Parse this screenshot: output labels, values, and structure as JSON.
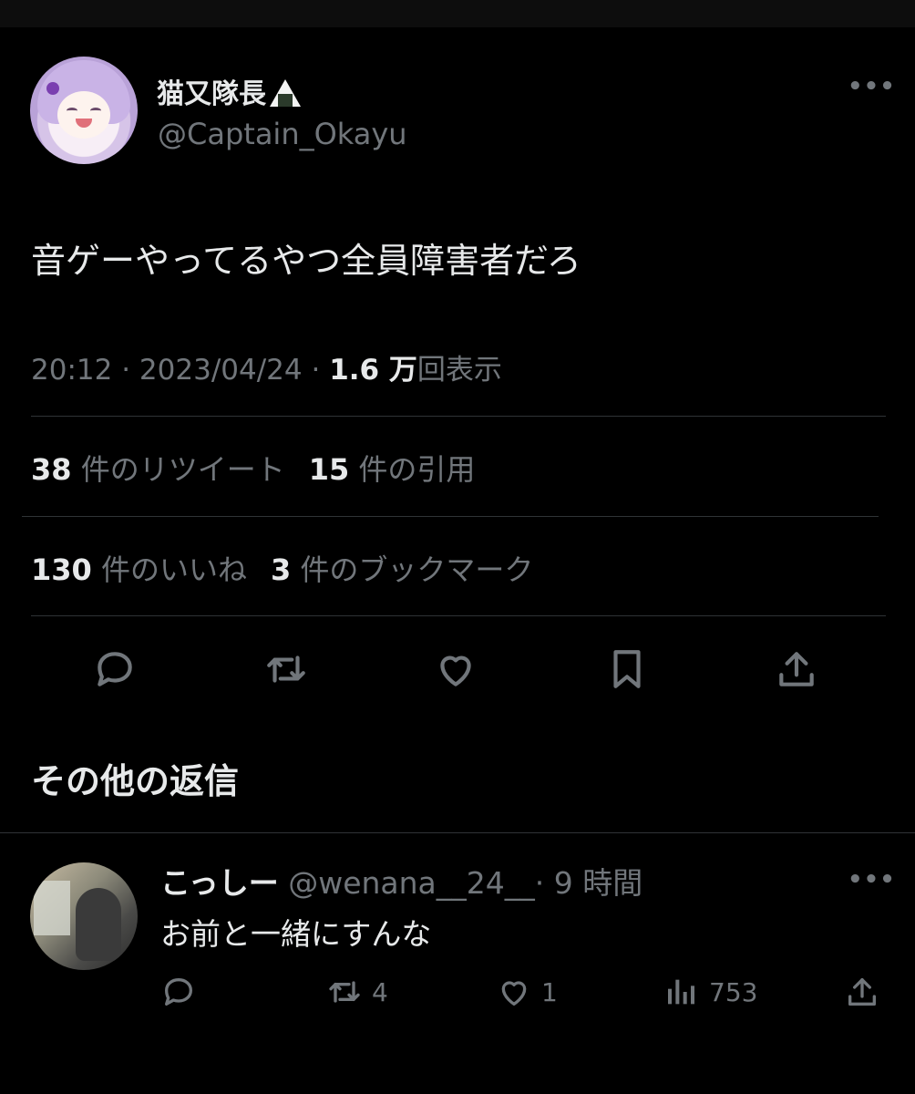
{
  "tweet": {
    "author": {
      "name": "猫又隊長",
      "handle": "@Captain_Okayu"
    },
    "text": "音ゲーやってるやつ全員障害者だろ",
    "time": "20:12",
    "date": "2023/04/24",
    "views_value": "1.6 万",
    "views_label": "回表示",
    "stats": {
      "retweets": {
        "count": "38",
        "label": "件のリツイート"
      },
      "quotes": {
        "count": "15",
        "label": "件の引用"
      },
      "likes": {
        "count": "130",
        "label": "件のいいね"
      },
      "bookmarks": {
        "count": "3",
        "label": "件のブックマーク"
      }
    },
    "icons": [
      "reply-icon",
      "retweet-icon",
      "like-icon",
      "bookmark-icon",
      "share-icon"
    ]
  },
  "replies_heading": "その他の返信",
  "reply": {
    "name": "こっしー",
    "handle": "@wenana__24__",
    "time": "· 9 時間",
    "text": "お前と一緒にすんな",
    "retweets": "4",
    "likes": "1",
    "views": "753"
  },
  "colors": {
    "background": "#000000",
    "text": "#e7e9ea",
    "muted": "#71767b",
    "divider": "#2f3336"
  }
}
